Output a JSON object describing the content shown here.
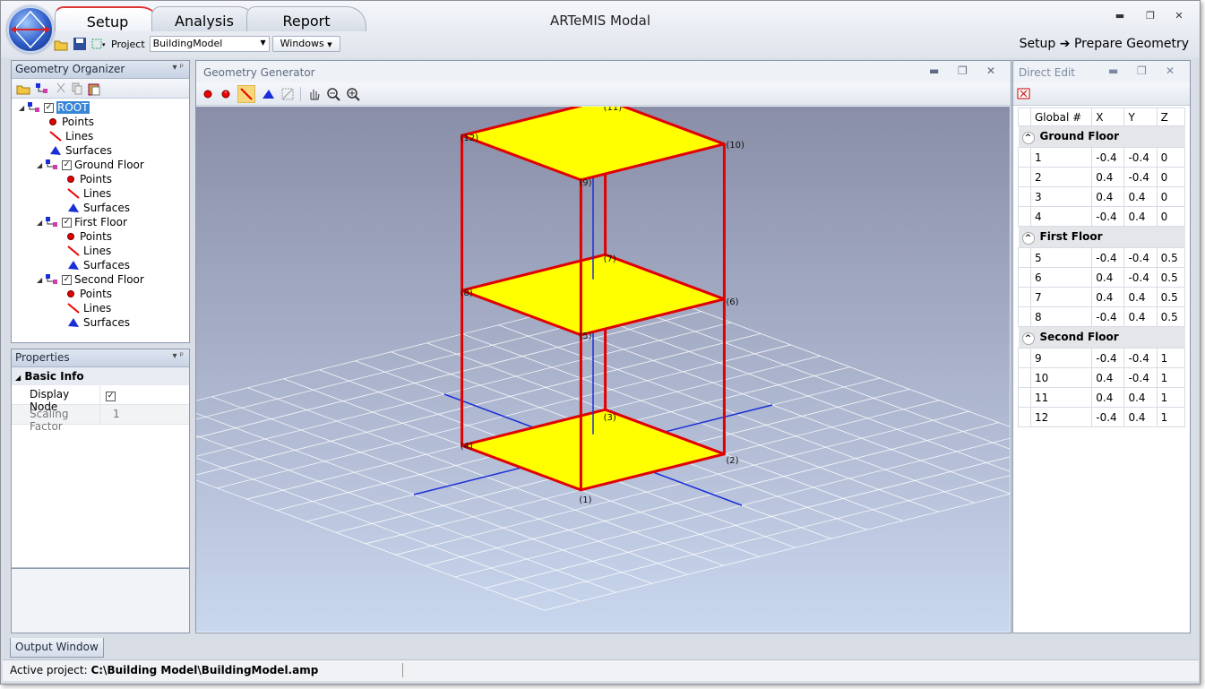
{
  "app": {
    "title": "ARTeMIS Modal"
  },
  "ribbon_tabs": [
    "Setup",
    "Analysis",
    "Report"
  ],
  "toolbar": {
    "project_label": "Project",
    "project_value": "BuildingModel",
    "windows_label": "Windows"
  },
  "breadcrumb": {
    "step": "Setup",
    "arrow": "➔",
    "target": "Prepare Geometry"
  },
  "organizer": {
    "title": "Geometry Organizer",
    "root": "ROOT",
    "root_children": [
      "Points",
      "Lines",
      "Surfaces"
    ],
    "groups": [
      {
        "name": "Ground Floor",
        "children": [
          "Points",
          "Lines",
          "Surfaces"
        ]
      },
      {
        "name": "First Floor",
        "children": [
          "Points",
          "Lines",
          "Surfaces"
        ]
      },
      {
        "name": "Second Floor",
        "children": [
          "Points",
          "Lines",
          "Surfaces"
        ]
      }
    ]
  },
  "properties": {
    "title": "Properties",
    "section": "Basic Info",
    "display_node_label": "Display Node",
    "scaling_factor_label": "Scaling Factor",
    "scaling_factor_value": "1"
  },
  "generator": {
    "title": "Geometry Generator",
    "view_label": "ROOT",
    "node_labels": [
      "(1)",
      "(2)",
      "(3)",
      "(4)",
      "(5)",
      "(6)",
      "(7)",
      "(8)",
      "(9)",
      "(10)",
      "(11)",
      "(12)"
    ]
  },
  "direct_edit": {
    "title": "Direct Edit",
    "columns": [
      "Global #",
      "X",
      "Y",
      "Z"
    ],
    "groups": [
      {
        "name": "Ground Floor",
        "rows": [
          [
            "1",
            "-0.4",
            "-0.4",
            "0"
          ],
          [
            "2",
            "0.4",
            "-0.4",
            "0"
          ],
          [
            "3",
            "0.4",
            "0.4",
            "0"
          ],
          [
            "4",
            "-0.4",
            "0.4",
            "0"
          ]
        ]
      },
      {
        "name": "First Floor",
        "rows": [
          [
            "5",
            "-0.4",
            "-0.4",
            "0.5"
          ],
          [
            "6",
            "0.4",
            "-0.4",
            "0.5"
          ],
          [
            "7",
            "0.4",
            "0.4",
            "0.5"
          ],
          [
            "8",
            "-0.4",
            "0.4",
            "0.5"
          ]
        ]
      },
      {
        "name": "Second Floor",
        "rows": [
          [
            "9",
            "-0.4",
            "-0.4",
            "1"
          ],
          [
            "10",
            "0.4",
            "-0.4",
            "1"
          ],
          [
            "11",
            "0.4",
            "0.4",
            "1"
          ],
          [
            "12",
            "-0.4",
            "0.4",
            "1"
          ]
        ]
      }
    ]
  },
  "output_tab": "Output Window",
  "status": {
    "label": "Active project:",
    "path": "C:\\Building Model\\BuildingModel.amp"
  },
  "colors": {
    "surface": "#ffff00",
    "edge": "#e00000",
    "axis": "#1a2ed8",
    "selection": "#3a86d6"
  }
}
